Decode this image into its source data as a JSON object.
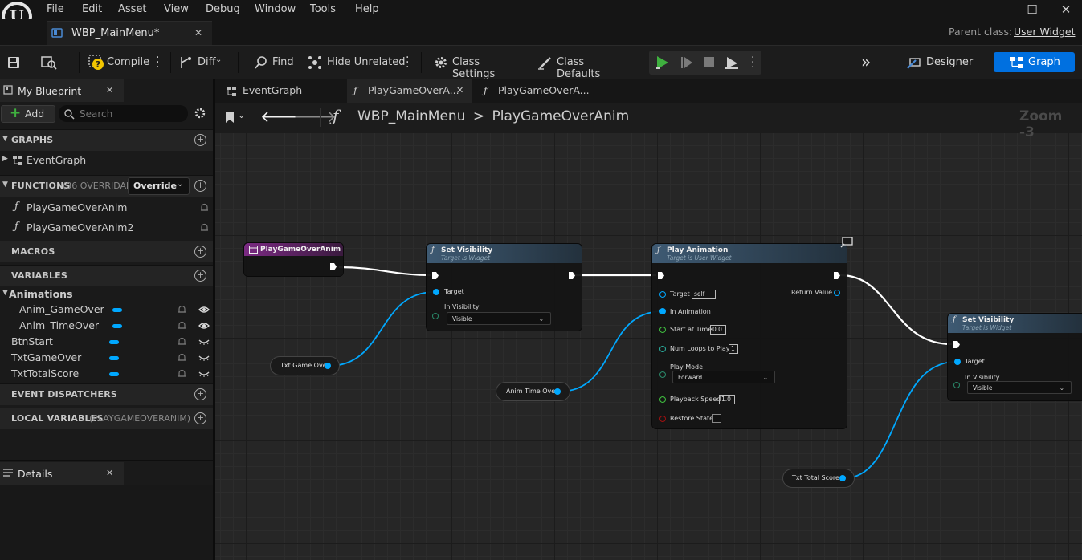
{
  "menu": {
    "items": [
      "File",
      "Edit",
      "Asset",
      "View",
      "Debug",
      "Window",
      "Tools",
      "Help"
    ]
  },
  "window": {
    "minimize": "—",
    "maximize": "☐",
    "close": "✕"
  },
  "doc_tab": {
    "label": "WBP_MainMenu*",
    "close": "✕"
  },
  "parent_class": {
    "label": "Parent class:",
    "value": "User Widget"
  },
  "toolbar": {
    "compile": "Compile",
    "diff": "Diff",
    "find": "Find",
    "hide_unrelated": "Hide Unrelated",
    "class_settings": "Class Settings",
    "class_defaults": "Class Defaults",
    "designer": "Designer",
    "graph": "Graph",
    "more": "»"
  },
  "my_blueprint": {
    "tab_label": "My Blueprint",
    "close": "✕",
    "add_label": "Add",
    "search_placeholder": "Search",
    "graphs_title": "GRAPHS",
    "event_graph": "EventGraph",
    "functions_title": "FUNCTIONS",
    "functions_overridable": "(36 OVERRIDAB",
    "override_label": "Override",
    "functions": [
      "PlayGameOverAnim",
      "PlayGameOverAnim2"
    ],
    "macros_title": "MACROS",
    "variables_title": "VARIABLES",
    "animations_category": "Animations",
    "animations": [
      "Anim_GameOver",
      "Anim_TimeOver"
    ],
    "variables": [
      "BtnStart",
      "TxtGameOver",
      "TxtTotalScore"
    ],
    "event_dispatchers_title": "EVENT DISPATCHERS",
    "local_variables_title": "LOCAL VARIABLES",
    "local_variables_scope": "(PLAYGAMEOVERANIM)"
  },
  "details": {
    "tab_label": "Details",
    "close": "✕"
  },
  "graph_tabs": [
    {
      "label": "EventGraph"
    },
    {
      "label": "PlayGameOverA...",
      "close": "✕"
    },
    {
      "label": "PlayGameOverA..."
    }
  ],
  "breadcrumb": {
    "root": "WBP_MainMenu",
    "separator": ">",
    "current": "PlayGameOverAnim",
    "zoom": "Zoom -3"
  },
  "nodes": {
    "entry": {
      "title": "PlayGameOverAnim"
    },
    "set_vis1": {
      "title": "Set Visibility",
      "subtitle": "Target is Widget",
      "target": "Target",
      "in_visibility": "In Visibility",
      "visibility_value": "Visible"
    },
    "play_anim": {
      "title": "Play Animation",
      "subtitle": "Target is User Widget",
      "target": "Target",
      "target_value": "self",
      "in_animation": "In Animation",
      "return_value": "Return Value",
      "start_at_time": "Start at Time",
      "start_at_time_value": "0.0",
      "num_loops": "Num Loops to Play",
      "num_loops_value": "1",
      "play_mode": "Play Mode",
      "play_mode_value": "Forward",
      "playback_speed": "Playback Speed",
      "playback_speed_value": "1.0",
      "restore_state": "Restore State"
    },
    "set_vis2": {
      "title": "Set Visibility",
      "subtitle": "Target is Widget",
      "target": "Target",
      "in_visibility": "In Visibility",
      "visibility_value": "Visible"
    },
    "txt_game_over": {
      "label": "Txt Game Over"
    },
    "anim_time_over": {
      "label": "Anim Time Over"
    },
    "txt_total_score": {
      "label": "Txt Total Score"
    }
  },
  "colors": {
    "accent": "#0070e0",
    "exec_wire": "#ffffff",
    "object_wire": "#00a8ff",
    "function_header": "#3e5a73",
    "entry_header": "#7a2a82"
  }
}
